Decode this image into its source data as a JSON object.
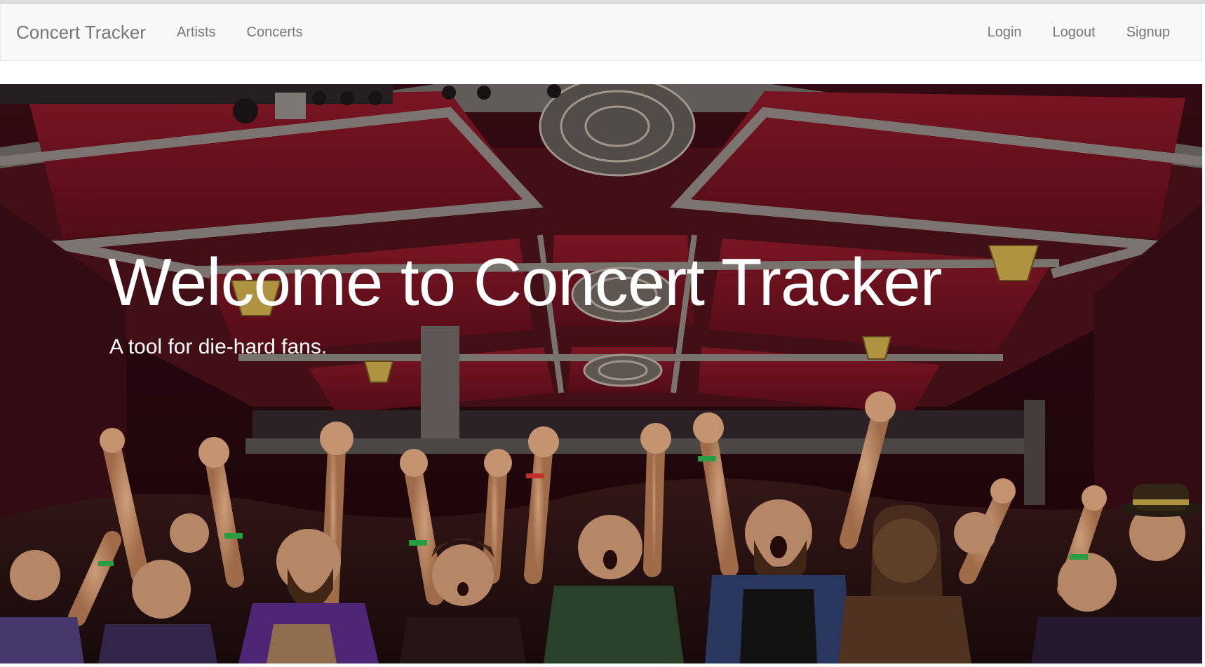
{
  "navbar": {
    "brand": "Concert Tracker",
    "left_links": [
      {
        "label": "Artists"
      },
      {
        "label": "Concerts"
      }
    ],
    "right_links": [
      {
        "label": "Login"
      },
      {
        "label": "Logout"
      },
      {
        "label": "Signup"
      }
    ]
  },
  "hero": {
    "title": "Welcome to Concert Tracker",
    "subtitle": "A tool for die-hard fans.",
    "image_subject": "concert-crowd-photo"
  },
  "colors": {
    "navbar_bg": "#f8f8f8",
    "nav_text": "#777777",
    "hero_text": "#ffffff",
    "ceiling_red": "#7a1422"
  }
}
